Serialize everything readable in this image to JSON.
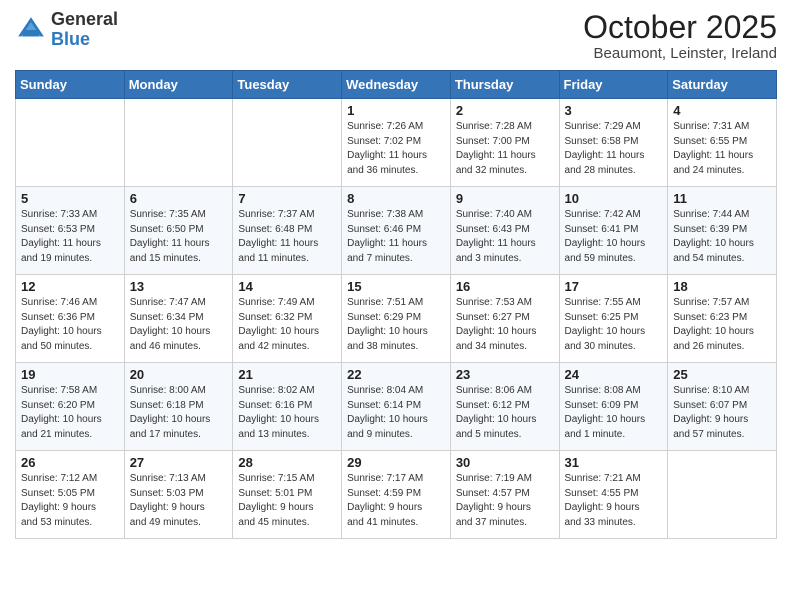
{
  "logo": {
    "general": "General",
    "blue": "Blue"
  },
  "title": "October 2025",
  "location": "Beaumont, Leinster, Ireland",
  "weekdays": [
    "Sunday",
    "Monday",
    "Tuesday",
    "Wednesday",
    "Thursday",
    "Friday",
    "Saturday"
  ],
  "weeks": [
    [
      {
        "day": "",
        "detail": ""
      },
      {
        "day": "",
        "detail": ""
      },
      {
        "day": "",
        "detail": ""
      },
      {
        "day": "1",
        "detail": "Sunrise: 7:26 AM\nSunset: 7:02 PM\nDaylight: 11 hours\nand 36 minutes."
      },
      {
        "day": "2",
        "detail": "Sunrise: 7:28 AM\nSunset: 7:00 PM\nDaylight: 11 hours\nand 32 minutes."
      },
      {
        "day": "3",
        "detail": "Sunrise: 7:29 AM\nSunset: 6:58 PM\nDaylight: 11 hours\nand 28 minutes."
      },
      {
        "day": "4",
        "detail": "Sunrise: 7:31 AM\nSunset: 6:55 PM\nDaylight: 11 hours\nand 24 minutes."
      }
    ],
    [
      {
        "day": "5",
        "detail": "Sunrise: 7:33 AM\nSunset: 6:53 PM\nDaylight: 11 hours\nand 19 minutes."
      },
      {
        "day": "6",
        "detail": "Sunrise: 7:35 AM\nSunset: 6:50 PM\nDaylight: 11 hours\nand 15 minutes."
      },
      {
        "day": "7",
        "detail": "Sunrise: 7:37 AM\nSunset: 6:48 PM\nDaylight: 11 hours\nand 11 minutes."
      },
      {
        "day": "8",
        "detail": "Sunrise: 7:38 AM\nSunset: 6:46 PM\nDaylight: 11 hours\nand 7 minutes."
      },
      {
        "day": "9",
        "detail": "Sunrise: 7:40 AM\nSunset: 6:43 PM\nDaylight: 11 hours\nand 3 minutes."
      },
      {
        "day": "10",
        "detail": "Sunrise: 7:42 AM\nSunset: 6:41 PM\nDaylight: 10 hours\nand 59 minutes."
      },
      {
        "day": "11",
        "detail": "Sunrise: 7:44 AM\nSunset: 6:39 PM\nDaylight: 10 hours\nand 54 minutes."
      }
    ],
    [
      {
        "day": "12",
        "detail": "Sunrise: 7:46 AM\nSunset: 6:36 PM\nDaylight: 10 hours\nand 50 minutes."
      },
      {
        "day": "13",
        "detail": "Sunrise: 7:47 AM\nSunset: 6:34 PM\nDaylight: 10 hours\nand 46 minutes."
      },
      {
        "day": "14",
        "detail": "Sunrise: 7:49 AM\nSunset: 6:32 PM\nDaylight: 10 hours\nand 42 minutes."
      },
      {
        "day": "15",
        "detail": "Sunrise: 7:51 AM\nSunset: 6:29 PM\nDaylight: 10 hours\nand 38 minutes."
      },
      {
        "day": "16",
        "detail": "Sunrise: 7:53 AM\nSunset: 6:27 PM\nDaylight: 10 hours\nand 34 minutes."
      },
      {
        "day": "17",
        "detail": "Sunrise: 7:55 AM\nSunset: 6:25 PM\nDaylight: 10 hours\nand 30 minutes."
      },
      {
        "day": "18",
        "detail": "Sunrise: 7:57 AM\nSunset: 6:23 PM\nDaylight: 10 hours\nand 26 minutes."
      }
    ],
    [
      {
        "day": "19",
        "detail": "Sunrise: 7:58 AM\nSunset: 6:20 PM\nDaylight: 10 hours\nand 21 minutes."
      },
      {
        "day": "20",
        "detail": "Sunrise: 8:00 AM\nSunset: 6:18 PM\nDaylight: 10 hours\nand 17 minutes."
      },
      {
        "day": "21",
        "detail": "Sunrise: 8:02 AM\nSunset: 6:16 PM\nDaylight: 10 hours\nand 13 minutes."
      },
      {
        "day": "22",
        "detail": "Sunrise: 8:04 AM\nSunset: 6:14 PM\nDaylight: 10 hours\nand 9 minutes."
      },
      {
        "day": "23",
        "detail": "Sunrise: 8:06 AM\nSunset: 6:12 PM\nDaylight: 10 hours\nand 5 minutes."
      },
      {
        "day": "24",
        "detail": "Sunrise: 8:08 AM\nSunset: 6:09 PM\nDaylight: 10 hours\nand 1 minute."
      },
      {
        "day": "25",
        "detail": "Sunrise: 8:10 AM\nSunset: 6:07 PM\nDaylight: 9 hours\nand 57 minutes."
      }
    ],
    [
      {
        "day": "26",
        "detail": "Sunrise: 7:12 AM\nSunset: 5:05 PM\nDaylight: 9 hours\nand 53 minutes."
      },
      {
        "day": "27",
        "detail": "Sunrise: 7:13 AM\nSunset: 5:03 PM\nDaylight: 9 hours\nand 49 minutes."
      },
      {
        "day": "28",
        "detail": "Sunrise: 7:15 AM\nSunset: 5:01 PM\nDaylight: 9 hours\nand 45 minutes."
      },
      {
        "day": "29",
        "detail": "Sunrise: 7:17 AM\nSunset: 4:59 PM\nDaylight: 9 hours\nand 41 minutes."
      },
      {
        "day": "30",
        "detail": "Sunrise: 7:19 AM\nSunset: 4:57 PM\nDaylight: 9 hours\nand 37 minutes."
      },
      {
        "day": "31",
        "detail": "Sunrise: 7:21 AM\nSunset: 4:55 PM\nDaylight: 9 hours\nand 33 minutes."
      },
      {
        "day": "",
        "detail": ""
      }
    ]
  ]
}
